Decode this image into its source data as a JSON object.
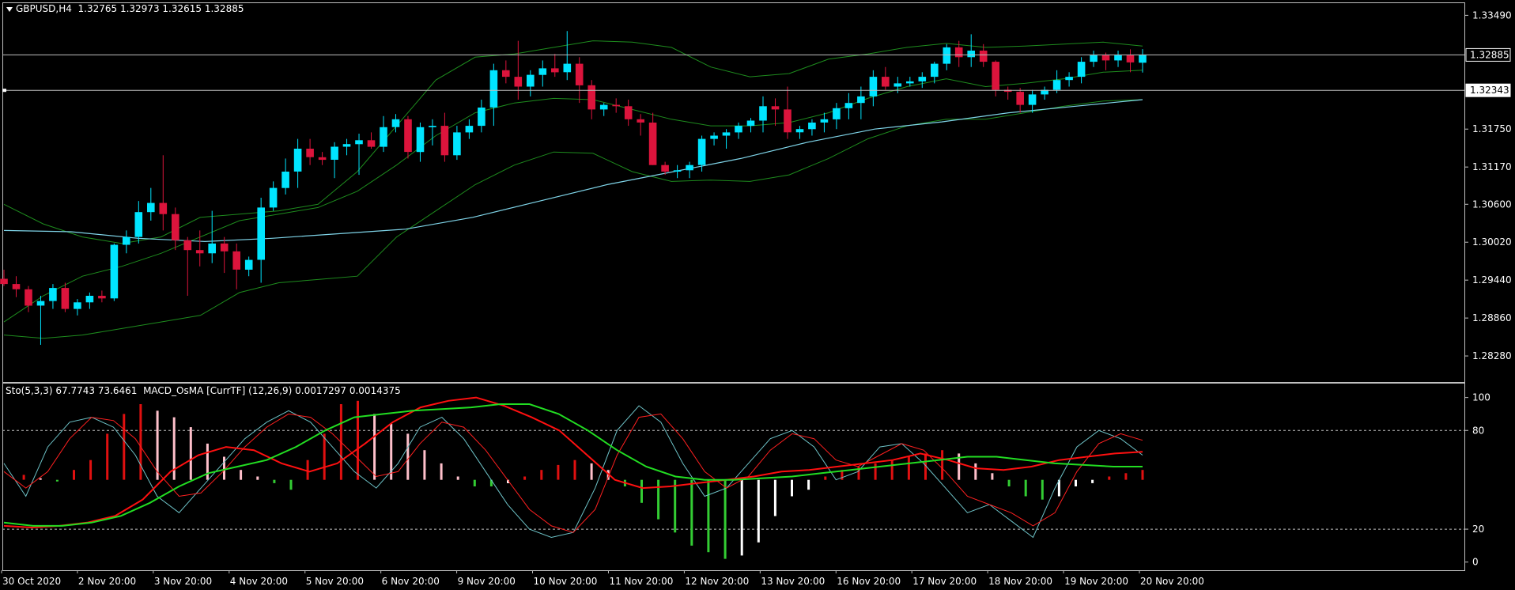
{
  "header": {
    "symbol": "GBPUSD,H4",
    "ohlc": "1.32765 1.32973 1.32615 1.32885",
    "indicator": "Sto(5,3,3) 67.7743 73.6461  MACD_OsMA [CurrTF] (12,26,9) 0.0017297 0.0014375"
  },
  "colors": {
    "background": "#000000",
    "bull": "#00e5ff",
    "bear": "#dc143c",
    "bollinger": "#1e8c1e",
    "ma": "#7fd4e8",
    "stoch_main": "#6ec3c8",
    "stoch_signal": "#ff2020",
    "macd_line": "#ff1010",
    "macd_signal": "#22dd22",
    "hist_up_strong": "#e01010",
    "hist_up_weak": "#ffc0cb",
    "hist_down_strong": "#33cc33",
    "hist_down_weak": "#ffffff",
    "grid": "#c0c0c0"
  },
  "chart_data": [
    {
      "type": "candlestick",
      "title": "GBPUSD,H4",
      "x_labels": [
        "30 Oct 2020",
        "2 Nov 20:00",
        "3 Nov 20:00",
        "4 Nov 20:00",
        "5 Nov 20:00",
        "6 Nov 20:00",
        "9 Nov 20:00",
        "10 Nov 20:00",
        "11 Nov 20:00",
        "12 Nov 20:00",
        "13 Nov 20:00",
        "16 Nov 20:00",
        "17 Nov 20:00",
        "18 Nov 20:00",
        "19 Nov 20:00",
        "20 Nov 20:00"
      ],
      "y_ticks": [
        "1.33490",
        "1.32885",
        "1.32343",
        "1.31750",
        "1.31170",
        "1.30600",
        "1.30020",
        "1.29440",
        "1.28860",
        "1.28280"
      ],
      "ylim": [
        1.2793,
        1.3364
      ],
      "price_lines": [
        {
          "label": "1.32885",
          "value": 1.32885
        },
        {
          "label": "1.32343",
          "value": 1.32343
        }
      ],
      "candles": [
        [
          1.2946,
          1.296,
          1.2935,
          1.2938
        ],
        [
          1.2938,
          1.295,
          1.2918,
          1.293
        ],
        [
          1.293,
          1.2935,
          1.2895,
          1.2905
        ],
        [
          1.2905,
          1.292,
          1.2845,
          1.2912
        ],
        [
          1.2912,
          1.2938,
          1.29,
          1.2932
        ],
        [
          1.2932,
          1.294,
          1.2895,
          1.29
        ],
        [
          1.29,
          1.2915,
          1.289,
          1.291
        ],
        [
          1.291,
          1.2925,
          1.29,
          1.292
        ],
        [
          1.292,
          1.2928,
          1.291,
          1.2916
        ],
        [
          1.2916,
          1.3,
          1.2912,
          1.2998
        ],
        [
          1.2998,
          1.302,
          1.2985,
          1.301
        ],
        [
          1.301,
          1.3065,
          1.3,
          1.3048
        ],
        [
          1.3048,
          1.3085,
          1.3035,
          1.3062
        ],
        [
          1.3062,
          1.3135,
          1.302,
          1.3045
        ],
        [
          1.3045,
          1.3055,
          1.299,
          1.3005
        ],
        [
          1.3005,
          1.301,
          1.292,
          1.299
        ],
        [
          1.299,
          1.302,
          1.2965,
          1.2985
        ],
        [
          1.2985,
          1.305,
          1.297,
          1.3
        ],
        [
          1.3,
          1.301,
          1.2955,
          1.2988
        ],
        [
          1.2988,
          1.3,
          1.293,
          1.296
        ],
        [
          1.296,
          1.298,
          1.295,
          1.2975
        ],
        [
          1.2975,
          1.307,
          1.294,
          1.3055
        ],
        [
          1.3055,
          1.3095,
          1.305,
          1.3085
        ],
        [
          1.3085,
          1.313,
          1.3075,
          1.311
        ],
        [
          1.311,
          1.316,
          1.3085,
          1.3145
        ],
        [
          1.3145,
          1.316,
          1.312,
          1.3132
        ],
        [
          1.3132,
          1.314,
          1.312,
          1.3128
        ],
        [
          1.3128,
          1.3155,
          1.31,
          1.3148
        ],
        [
          1.3148,
          1.316,
          1.3135,
          1.3152
        ],
        [
          1.3152,
          1.3168,
          1.3105,
          1.3158
        ],
        [
          1.3158,
          1.317,
          1.3145,
          1.3148
        ],
        [
          1.3148,
          1.3195,
          1.314,
          1.3178
        ],
        [
          1.3178,
          1.3198,
          1.317,
          1.319
        ],
        [
          1.319,
          1.3195,
          1.313,
          1.314
        ],
        [
          1.314,
          1.3185,
          1.3125,
          1.3178
        ],
        [
          1.3178,
          1.319,
          1.315,
          1.318
        ],
        [
          1.318,
          1.32,
          1.3125,
          1.3135
        ],
        [
          1.3135,
          1.318,
          1.3128,
          1.317
        ],
        [
          1.317,
          1.319,
          1.316,
          1.318
        ],
        [
          1.318,
          1.322,
          1.317,
          1.3208
        ],
        [
          1.3208,
          1.3275,
          1.318,
          1.3265
        ],
        [
          1.3265,
          1.328,
          1.3245,
          1.3255
        ],
        [
          1.3255,
          1.331,
          1.322,
          1.324
        ],
        [
          1.324,
          1.3265,
          1.3225,
          1.3258
        ],
        [
          1.3258,
          1.328,
          1.324,
          1.3268
        ],
        [
          1.3268,
          1.329,
          1.3255,
          1.3262
        ],
        [
          1.3262,
          1.3325,
          1.325,
          1.3275
        ],
        [
          1.3275,
          1.3285,
          1.3215,
          1.3242
        ],
        [
          1.3242,
          1.325,
          1.319,
          1.3205
        ],
        [
          1.3205,
          1.3215,
          1.3195,
          1.3212
        ],
        [
          1.3212,
          1.3222,
          1.32,
          1.321
        ],
        [
          1.321,
          1.322,
          1.318,
          1.319
        ],
        [
          1.319,
          1.3198,
          1.3165,
          1.3185
        ],
        [
          1.3185,
          1.32,
          1.312,
          1.312
        ],
        [
          1.312,
          1.3125,
          1.3105,
          1.311
        ],
        [
          1.311,
          1.312,
          1.31,
          1.3112
        ],
        [
          1.3112,
          1.3125,
          1.31,
          1.312
        ],
        [
          1.312,
          1.3165,
          1.311,
          1.316
        ],
        [
          1.316,
          1.317,
          1.315,
          1.3165
        ],
        [
          1.3165,
          1.3175,
          1.3145,
          1.317
        ],
        [
          1.317,
          1.3185,
          1.316,
          1.318
        ],
        [
          1.318,
          1.3192,
          1.317,
          1.3188
        ],
        [
          1.3188,
          1.3225,
          1.317,
          1.321
        ],
        [
          1.321,
          1.3222,
          1.318,
          1.3205
        ],
        [
          1.3205,
          1.324,
          1.316,
          1.317
        ],
        [
          1.317,
          1.318,
          1.316,
          1.3175
        ],
        [
          1.3175,
          1.319,
          1.3165,
          1.3185
        ],
        [
          1.3185,
          1.32,
          1.317,
          1.319
        ],
        [
          1.319,
          1.3215,
          1.3175,
          1.3207
        ],
        [
          1.3207,
          1.323,
          1.319,
          1.3215
        ],
        [
          1.3215,
          1.324,
          1.319,
          1.3225
        ],
        [
          1.3225,
          1.3265,
          1.321,
          1.3255
        ],
        [
          1.3255,
          1.327,
          1.3235,
          1.324
        ],
        [
          1.324,
          1.3255,
          1.323,
          1.3245
        ],
        [
          1.3245,
          1.3255,
          1.324,
          1.3248
        ],
        [
          1.3248,
          1.3262,
          1.3238,
          1.3255
        ],
        [
          1.3255,
          1.3278,
          1.3245,
          1.3275
        ],
        [
          1.3275,
          1.3305,
          1.3265,
          1.33
        ],
        [
          1.33,
          1.331,
          1.327,
          1.3285
        ],
        [
          1.3285,
          1.332,
          1.327,
          1.3295
        ],
        [
          1.3295,
          1.3305,
          1.327,
          1.3278
        ],
        [
          1.3278,
          1.328,
          1.3225,
          1.3235
        ],
        [
          1.3235,
          1.324,
          1.322,
          1.3232
        ],
        [
          1.3232,
          1.3238,
          1.32,
          1.3212
        ],
        [
          1.3212,
          1.3235,
          1.32,
          1.3228
        ],
        [
          1.3228,
          1.324,
          1.322,
          1.3235
        ],
        [
          1.3235,
          1.3265,
          1.323,
          1.325
        ],
        [
          1.325,
          1.3262,
          1.324,
          1.3255
        ],
        [
          1.3255,
          1.3285,
          1.3245,
          1.3278
        ],
        [
          1.3278,
          1.3295,
          1.327,
          1.3288
        ],
        [
          1.3288,
          1.3292,
          1.3265,
          1.328
        ],
        [
          1.328,
          1.3295,
          1.327,
          1.3288
        ],
        [
          1.3288,
          1.3297,
          1.3262,
          1.3277
        ],
        [
          1.32765,
          1.32973,
          1.32615,
          1.32885
        ]
      ],
      "bollinger_upper": [
        1.306,
        1.303,
        1.301,
        1.3,
        1.301,
        1.304,
        1.3045,
        1.305,
        1.306,
        1.311,
        1.318,
        1.325,
        1.3285,
        1.329,
        1.33,
        1.331,
        1.3308,
        1.33,
        1.327,
        1.3255,
        1.326,
        1.3282,
        1.329,
        1.33,
        1.3306,
        1.33,
        1.3302,
        1.3305,
        1.3308,
        1.3302
      ],
      "bollinger_middle": [
        1.288,
        1.292,
        1.295,
        1.2965,
        1.2985,
        1.301,
        1.3035,
        1.3045,
        1.3055,
        1.308,
        1.312,
        1.3165,
        1.32,
        1.3215,
        1.3222,
        1.322,
        1.3205,
        1.319,
        1.318,
        1.318,
        1.3185,
        1.32,
        1.3222,
        1.324,
        1.3252,
        1.324,
        1.3245,
        1.3252,
        1.3262,
        1.3265
      ],
      "bollinger_lower": [
        1.286,
        1.2855,
        1.286,
        1.287,
        1.288,
        1.289,
        1.2925,
        1.294,
        1.2945,
        1.295,
        1.301,
        1.305,
        1.309,
        1.312,
        1.314,
        1.3138,
        1.311,
        1.3095,
        1.3097,
        1.3095,
        1.3105,
        1.313,
        1.316,
        1.318,
        1.319,
        1.319,
        1.32,
        1.321,
        1.3218,
        1.322
      ],
      "moving_average": [
        1.302,
        1.3018,
        1.3008,
        1.3003,
        1.3008,
        1.3015,
        1.3022,
        1.304,
        1.3065,
        1.309,
        1.311,
        1.313,
        1.3155,
        1.3175,
        1.3186,
        1.32,
        1.321,
        1.322
      ]
    },
    {
      "type": "line",
      "title": "Sto(5,3,3) 67.7743 73.6461  MACD_OsMA [CurrTF] (12,26,9) 0.0017297 0.0014375",
      "y_ticks": [
        "100",
        "80",
        "20",
        "0"
      ],
      "ylim": [
        -4,
        108
      ],
      "levels": [
        80,
        20
      ],
      "stoch_main": [
        60,
        40,
        70,
        85,
        88,
        82,
        65,
        40,
        30,
        45,
        60,
        75,
        85,
        92,
        85,
        70,
        55,
        45,
        60,
        82,
        88,
        75,
        55,
        35,
        20,
        15,
        18,
        45,
        80,
        95,
        85,
        60,
        40,
        45,
        60,
        75,
        80,
        70,
        50,
        55,
        70,
        72,
        60,
        45,
        30,
        35,
        25,
        15,
        45,
        70,
        80,
        75,
        65
      ],
      "stoch_signal": [
        55,
        45,
        55,
        75,
        88,
        86,
        75,
        55,
        40,
        42,
        55,
        70,
        82,
        90,
        88,
        78,
        65,
        52,
        55,
        72,
        85,
        82,
        68,
        50,
        32,
        22,
        18,
        32,
        65,
        88,
        90,
        75,
        55,
        45,
        52,
        68,
        78,
        75,
        62,
        58,
        65,
        72,
        68,
        55,
        40,
        35,
        30,
        22,
        30,
        55,
        72,
        78,
        74
      ],
      "macd_line": [
        22,
        21,
        22,
        24,
        28,
        38,
        55,
        65,
        70,
        68,
        60,
        55,
        60,
        72,
        85,
        94,
        98,
        100,
        95,
        88,
        80,
        65,
        50,
        45,
        46,
        48,
        50,
        52,
        55,
        56,
        58,
        60,
        62,
        66,
        62,
        57,
        56,
        58,
        62,
        64,
        66,
        67
      ],
      "macd_signal": [
        24,
        22,
        22,
        24,
        28,
        36,
        46,
        54,
        58,
        62,
        70,
        80,
        88,
        90,
        92,
        93,
        94,
        96,
        96,
        90,
        80,
        68,
        58,
        52,
        50,
        50,
        51,
        52,
        54,
        56,
        58,
        60,
        62,
        64,
        64,
        62,
        60,
        59,
        58,
        58
      ],
      "histogram": [
        null,
        3,
        1,
        -1,
        6,
        12,
        28,
        40,
        46,
        42,
        38,
        32,
        22,
        14,
        6,
        2,
        -2,
        -6,
        12,
        28,
        46,
        48,
        40,
        34,
        28,
        18,
        10,
        2,
        -4,
        -4,
        -2,
        2,
        6,
        9,
        12,
        10,
        6,
        -4,
        -14,
        -24,
        -32,
        -40,
        -44,
        -48,
        -46,
        -38,
        -22,
        -10,
        -6,
        2,
        6,
        8,
        10,
        12,
        14,
        16,
        18,
        16,
        10,
        4,
        -4,
        -10,
        -12,
        -10,
        -4,
        -2,
        2,
        4,
        6
      ]
    }
  ]
}
